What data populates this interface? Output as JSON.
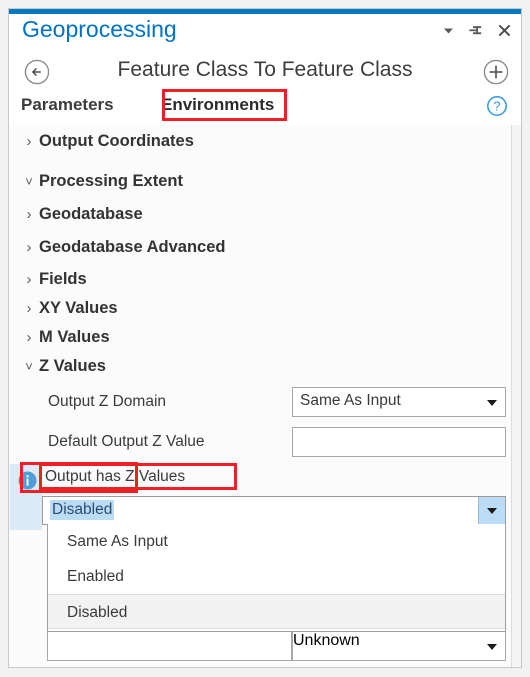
{
  "window": {
    "panel_title": "Geoprocessing",
    "accent_color": "#0079c1",
    "titlebar_icons": [
      {
        "name": "menu-dropdown-icon",
        "glyph": "chevron-down"
      },
      {
        "name": "pin-icon",
        "glyph": "pin"
      },
      {
        "name": "close-icon",
        "glyph": "x"
      }
    ]
  },
  "tool_header": {
    "back_label": "back-arrow",
    "title": "Feature Class To Feature Class",
    "add_label": "add-to-favorites"
  },
  "tabs": {
    "inactive_label": "Parameters",
    "active_label": "Environments",
    "help_label": "?"
  },
  "sections": [
    {
      "label": "Output Coordinates",
      "expanded": false
    },
    {
      "label": "Processing Extent",
      "expanded": true
    },
    {
      "label": "Geodatabase",
      "expanded": false
    },
    {
      "label": "Geodatabase Advanced",
      "expanded": false
    },
    {
      "label": "Fields",
      "expanded": false
    },
    {
      "label": "XY Values",
      "expanded": false
    },
    {
      "label": "M Values",
      "expanded": false
    },
    {
      "label": "Z Values",
      "expanded": true
    }
  ],
  "z_values": {
    "output_z_domain": {
      "label": "Output Z Domain",
      "value": "Same As Input"
    },
    "default_output_z_value": {
      "label": "Default Output Z Value",
      "value": ""
    },
    "output_has_z_values": {
      "label": "Output has Z Values",
      "selected_value": "Disabled",
      "options": [
        "Same As Input",
        "Enabled",
        "Disabled"
      ],
      "highlighted_option": "Disabled"
    }
  },
  "bottom_row": {
    "left_value": "",
    "right_value": "Unknown"
  },
  "annotations": {
    "highlight_color": "#ed2024",
    "boxes": [
      {
        "name": "environments-tab",
        "target": "Environments"
      },
      {
        "name": "z-values-section",
        "target": "Z Values"
      },
      {
        "name": "output-has-z-label",
        "target": "Output has Z Values"
      }
    ]
  }
}
